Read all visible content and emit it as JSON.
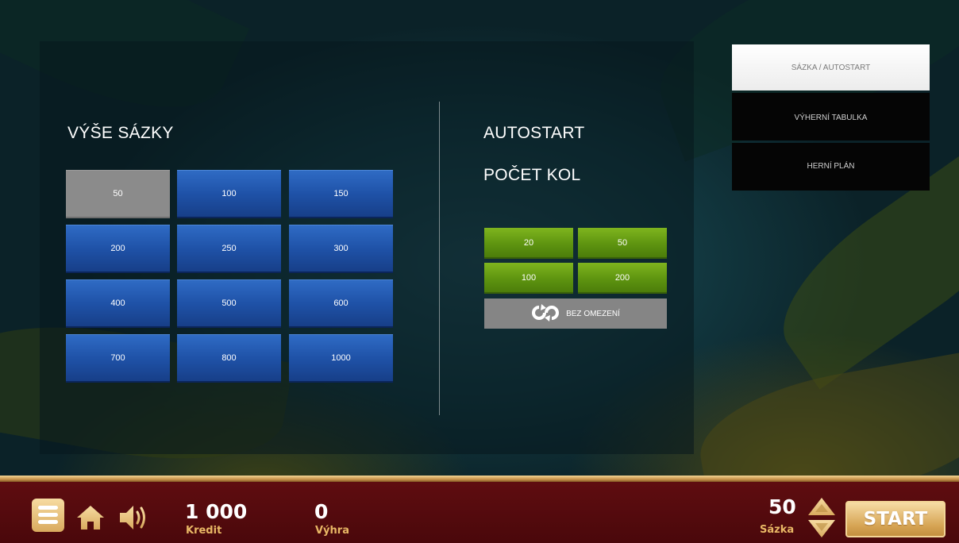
{
  "bet_section": {
    "heading": "VÝŠE SÁZKY",
    "options": [
      "50",
      "100",
      "150",
      "200",
      "250",
      "300",
      "400",
      "500",
      "600",
      "700",
      "800",
      "1000"
    ],
    "selected": "50"
  },
  "autostart": {
    "heading": "AUTOSTART",
    "rounds_heading": "POČET KOL",
    "round_options": [
      "20",
      "50",
      "100",
      "200"
    ],
    "unlimited_label": "BEZ OMEZENÍ"
  },
  "tabs": {
    "bet_autostart": "SÁZKA / AUTOSTART",
    "paytable": "VÝHERNÍ TABULKA",
    "rules": "HERNÍ PLÁN",
    "active": "SÁZKA / AUTOSTART"
  },
  "bottom_bar": {
    "credit_value": "1 000",
    "credit_label": "Kredit",
    "win_value": "0",
    "win_label": "Výhra",
    "bet_value": "50",
    "bet_label": "Sázka",
    "start_label": "START",
    "icons": [
      "menu-icon",
      "home-icon",
      "sound-icon",
      "bet-up-icon",
      "bet-down-icon"
    ]
  },
  "colors": {
    "bet_button": "#1f52a8",
    "bet_selected": "#8b8b8b",
    "round_button": "#5e9410",
    "unlimited_button": "#858585",
    "bar_background": "#5f0d10",
    "gold_accent": "#e8b765"
  }
}
